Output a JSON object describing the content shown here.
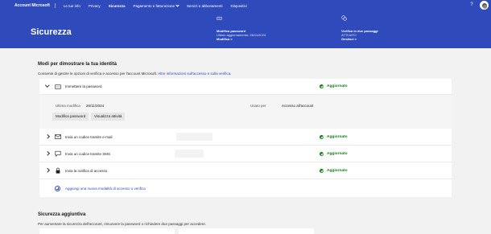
{
  "nav": {
    "brand": "Account Microsoft",
    "links": [
      "Le tue info",
      "Privacy",
      "Sicurezza",
      "Pagamento e fatturazione",
      "Servizi e abbonamenti",
      "Dispositivi"
    ],
    "active": "Sicurezza",
    "help": "?"
  },
  "hero": {
    "title": "Sicurezza",
    "password": {
      "label": "Modifica password",
      "sub": "Ultimo aggiornamento: 26/11/2024",
      "link": "Modifica >"
    },
    "twostep": {
      "label": "Verifica in due passaggi",
      "sub": "ATTIVATO",
      "link": "Gestisci >"
    }
  },
  "identity": {
    "title": "Modi per dimostrare la tua identità",
    "desc": "Consente di gestire le opzioni di verifica e accesso per l'account Microsoft.",
    "desc_link": "Altre informazioni sull'accesso e sulla verifica.",
    "password_row": {
      "label": "Immettere la password",
      "status": "Aggiornato",
      "last_modified_key": "Ultima modifica",
      "last_modified_value": "26/11/2024",
      "used_for_key": "Usato per",
      "used_for_value": "Accesso all'account",
      "btn_change": "Modifica password",
      "btn_activity": "Visualizza attività"
    },
    "rows": [
      {
        "label": "Invia un codice tramite e-mail",
        "status": "Aggiornato"
      },
      {
        "label": "Invia un codice tramite SMS",
        "status": "Aggiornato"
      },
      {
        "label": "Invia la notifica di accesso",
        "status": "Aggiornato"
      }
    ],
    "add_label": "Aggiungi una nuova modalità di accesso o verifica"
  },
  "extra": {
    "title": "Sicurezza aggiuntiva",
    "desc": "Per aumentare la sicurezza dell'account, rimuovere la password o richiedere due passaggi per accedere."
  },
  "colors": {
    "brand": "#2f4aba",
    "success": "#107c10"
  }
}
